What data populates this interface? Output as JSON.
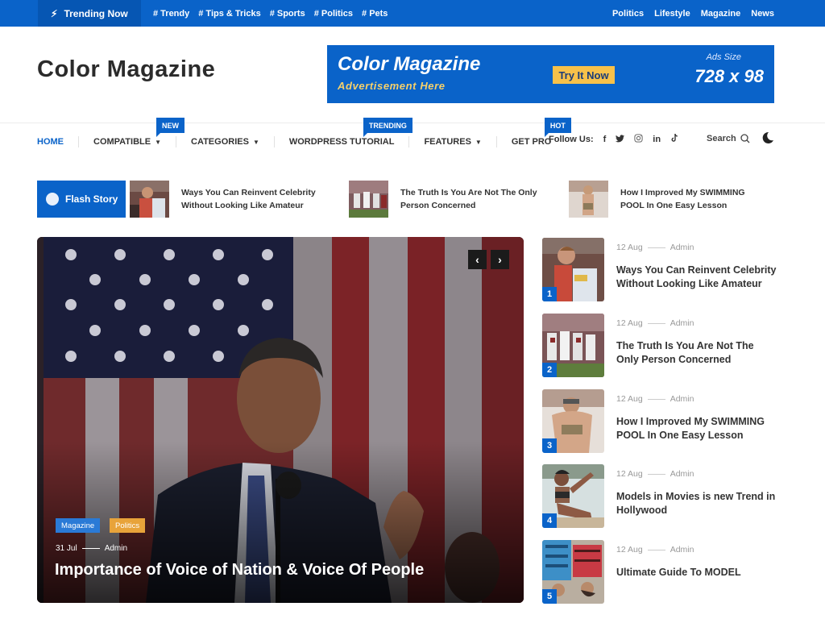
{
  "topbar": {
    "trending_label": "Trending Now",
    "tags": [
      "# Trendy",
      "# Tips & Tricks",
      "# Sports",
      "# Politics",
      "# Pets"
    ],
    "links": [
      "Politics",
      "Lifestyle",
      "Magazine",
      "News"
    ],
    "background_color": "#0a63c9"
  },
  "header": {
    "logo": "Color Magazine",
    "ad": {
      "title": "Color Magazine",
      "subtitle": "Advertisement Here",
      "button": "Try It Now",
      "size_label": "Ads Size",
      "size": "728 x 98"
    }
  },
  "nav": {
    "items": [
      {
        "label": "HOME",
        "active": true
      },
      {
        "label": "COMPATIBLE",
        "dropdown": true,
        "badge": "NEW"
      },
      {
        "label": "CATEGORIES",
        "dropdown": true
      },
      {
        "label": "WORDPRESS TUTORIAL",
        "badge": "TRENDING"
      },
      {
        "label": "FEATURES",
        "dropdown": true
      },
      {
        "label": "GET PRO",
        "badge": "HOT"
      }
    ],
    "follow_label": "Follow Us:",
    "social": [
      "f",
      "twitter",
      "instagram",
      "in",
      "tiktok"
    ],
    "search_label": "Search"
  },
  "flash": {
    "label": "Flash Story",
    "items": [
      {
        "title": "Ways You Can Reinvent Celebrity Without Looking Like Amateur"
      },
      {
        "title": "The Truth Is You Are Not The Only Person Concerned"
      },
      {
        "title": "How I Improved My SWIMMING POOL In One Easy Lesson"
      }
    ]
  },
  "hero": {
    "categories": [
      {
        "label": "Magazine",
        "color": "#2a7ad6"
      },
      {
        "label": "Politics",
        "color": "#e8a33a"
      }
    ],
    "date": "31 Jul",
    "author": "Admin",
    "title": "Importance of Voice of Nation & Voice Of People",
    "prev_icon": "‹",
    "next_icon": "›"
  },
  "side_list": [
    {
      "num": "1",
      "date": "12 Aug",
      "author": "Admin",
      "title": "Ways You Can Reinvent Celebrity Without Looking Like Amateur"
    },
    {
      "num": "2",
      "date": "12 Aug",
      "author": "Admin",
      "title": "The Truth Is You Are Not The Only Person Concerned"
    },
    {
      "num": "3",
      "date": "12 Aug",
      "author": "Admin",
      "title": "How I Improved My SWIMMING POOL In One Easy Lesson"
    },
    {
      "num": "4",
      "date": "12 Aug",
      "author": "Admin",
      "title": "Models in Movies is new Trend in Hollywood"
    },
    {
      "num": "5",
      "date": "12 Aug",
      "author": "Admin",
      "title": "Ultimate Guide To MODEL"
    }
  ]
}
